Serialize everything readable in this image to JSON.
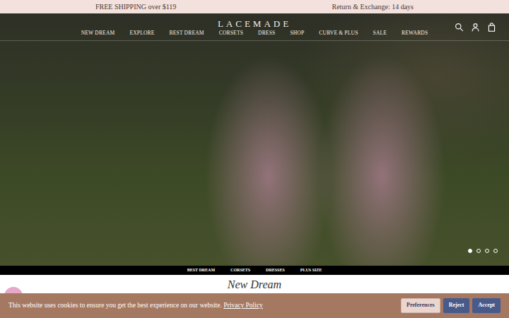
{
  "announcement": {
    "left": "FREE SHIPPING over $119",
    "right": "Return & Exchange: 14 days"
  },
  "logo": "LACEMADE",
  "nav": [
    "NEW DREAM",
    "EXPLORE",
    "BEST DREAM",
    "CORSETS",
    "DRESS",
    "SHOP",
    "CURVE & PLUS",
    "SALE",
    "REWARDS"
  ],
  "carousel": {
    "dots": [
      {
        "selected": true
      },
      {
        "selected": false
      },
      {
        "selected": false
      },
      {
        "selected": false
      }
    ]
  },
  "category_strip": [
    "BEST DREAM",
    "CORSETS",
    "DRESSES",
    "PLUS SIZE"
  ],
  "section_title": "New Dream",
  "cookie_banner": {
    "text": "This website uses cookies to ensure you get the best experience on our website.",
    "link": "Privacy Policy",
    "buttons": [
      "Preferences",
      "Reject",
      "Accept"
    ]
  }
}
